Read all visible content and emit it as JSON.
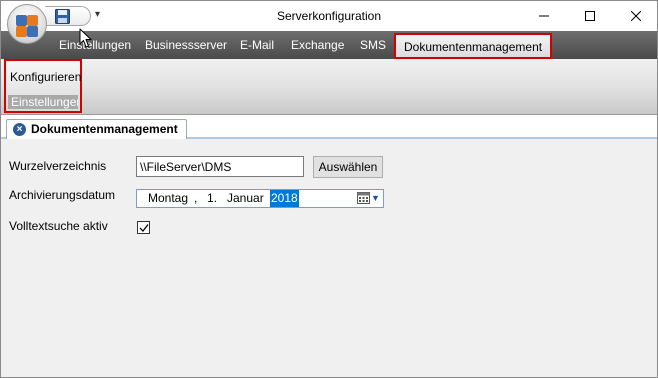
{
  "window": {
    "title": "Serverkonfiguration",
    "qat_dropdown": "▾",
    "controls": {
      "minimize": "—",
      "maximize": "☐",
      "close": "✕"
    }
  },
  "ribbon": {
    "tabs": [
      {
        "label": "Einstellungen"
      },
      {
        "label": "Businessserver"
      },
      {
        "label": "E-Mail"
      },
      {
        "label": "Exchange"
      },
      {
        "label": "SMS"
      },
      {
        "label": "Dokumentenmanagement",
        "active": true
      }
    ],
    "group": {
      "button_label": "Konfigurieren",
      "group_label": "Einstellungen"
    }
  },
  "document_tab": {
    "label": "Dokumentenmanagement",
    "close_glyph": "×"
  },
  "form": {
    "root_dir": {
      "label": "Wurzelverzeichnis",
      "value": "\\\\FileServer\\DMS",
      "button": "Auswählen"
    },
    "archive_date": {
      "label": "Archivierungsdatum",
      "weekday": "Montag",
      "separator": ",",
      "day": "1.",
      "month": "Januar",
      "year": "2018"
    },
    "fulltext": {
      "label": "Volltextsuche aktiv",
      "checked": true
    }
  },
  "colors": {
    "highlight_border": "#d40000",
    "ribbon_tab_bar": "#5a5a5a",
    "selection": "#0078d7",
    "content_bg": "#f0f0f0"
  },
  "icons": [
    "app-orb-icon",
    "save-icon",
    "minimize-icon",
    "maximize-icon",
    "close-icon",
    "tab-close-icon",
    "calendar-icon",
    "mouse-cursor-icon",
    "checkmark-icon"
  ]
}
